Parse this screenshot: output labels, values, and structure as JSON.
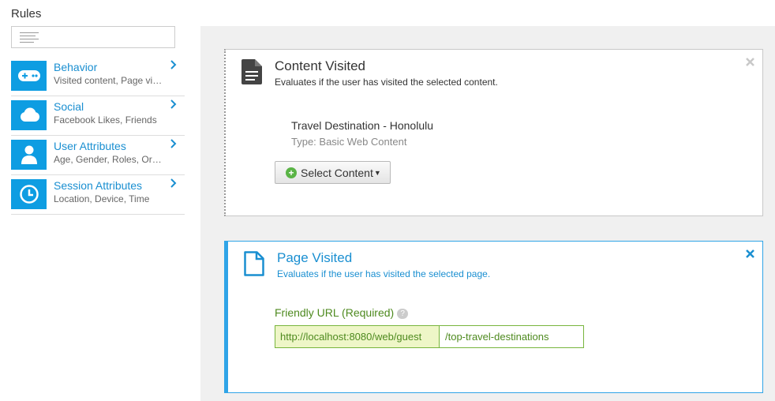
{
  "sidebar": {
    "title": "Rules",
    "categories": [
      {
        "label": "Behavior",
        "subtitle": "Visited content, Page visited"
      },
      {
        "label": "Social",
        "subtitle": "Facebook Likes, Friends"
      },
      {
        "label": "User Attributes",
        "subtitle": "Age, Gender, Roles, Organizations"
      },
      {
        "label": "Session Attributes",
        "subtitle": "Location, Device, Time"
      }
    ]
  },
  "rules": [
    {
      "title": "Content Visited",
      "description": "Evaluates if the user has visited the selected content.",
      "content_name": "Travel Destination - Honolulu",
      "content_type": "Type: Basic Web Content",
      "select_label": "Select Content"
    },
    {
      "title": "Page Visited",
      "description": "Evaluates if the user has visited the selected page.",
      "field_label": "Friendly URL (Required)",
      "url_prefix": "http://localhost:8080/web/guest",
      "url_value": "/top-travel-destinations"
    }
  ],
  "colors": {
    "accent": "#0e9de2",
    "link": "#1a8fd1",
    "success": "#4e8a1f"
  }
}
